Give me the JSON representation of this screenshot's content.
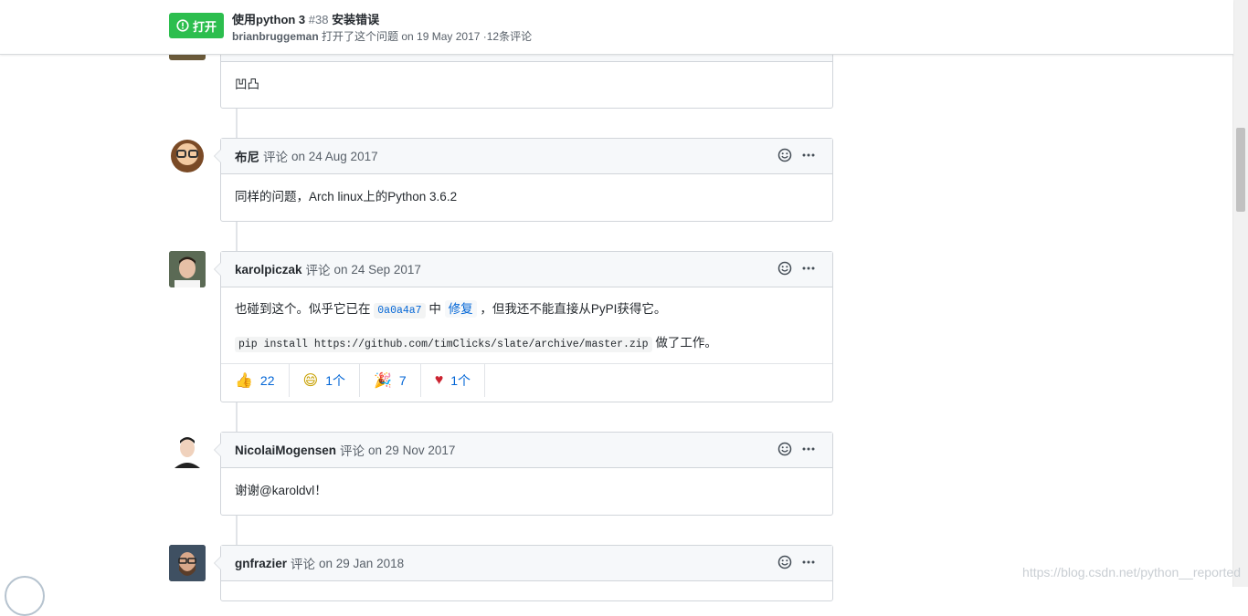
{
  "header": {
    "state_label": "打开",
    "title": "使用python 3",
    "issue_number": "#38",
    "title_suffix": "安装错误",
    "author": "brianbruggeman",
    "meta_text": "打开了这个问题 on 19 May 2017 ·12条评论"
  },
  "comments": [
    {
      "body_text": "凹凸"
    },
    {
      "author": "布尼",
      "verb": "评论",
      "date": "on 24 Aug 2017",
      "body_text": "同样的问题，Arch linux上的Python 3.6.2"
    },
    {
      "author": "karolpiczak",
      "verb": "评论",
      "date": "on 24 Sep 2017",
      "body_line1_prefix": "也碰到这个。似乎它已在",
      "body_line1_sha": "0a0a4a7",
      "body_line1_mid": "中",
      "body_line1_link": "修复",
      "body_line1_suffix": "，但我还不能直接从PyPI获得它。",
      "body_line2_code": "pip install https://github.com/timClicks/slate/archive/master.zip",
      "body_line2_suffix": "做了工作。",
      "reactions": [
        {
          "emoji": "thumbs-up",
          "glyph": "👍",
          "count": "22"
        },
        {
          "emoji": "laugh",
          "glyph": "😄",
          "count": "1个"
        },
        {
          "emoji": "hooray",
          "glyph": "🎉",
          "count": "7"
        },
        {
          "emoji": "heart",
          "glyph": "♥",
          "count": "1个"
        }
      ]
    },
    {
      "author": "NicolaiMogensen",
      "verb": "评论",
      "date": "on 29 Nov 2017",
      "body_text": "谢谢@karoldvl！"
    },
    {
      "author": "gnfrazier",
      "verb": "评论",
      "date": "on 29 Jan 2018"
    }
  ],
  "watermark": "https://blog.csdn.net/python__reported",
  "colors": {
    "open_green": "#2cbe4e",
    "link_blue": "#0366d6",
    "header_bg": "#f6f8fa",
    "border": "#d1d5da"
  }
}
